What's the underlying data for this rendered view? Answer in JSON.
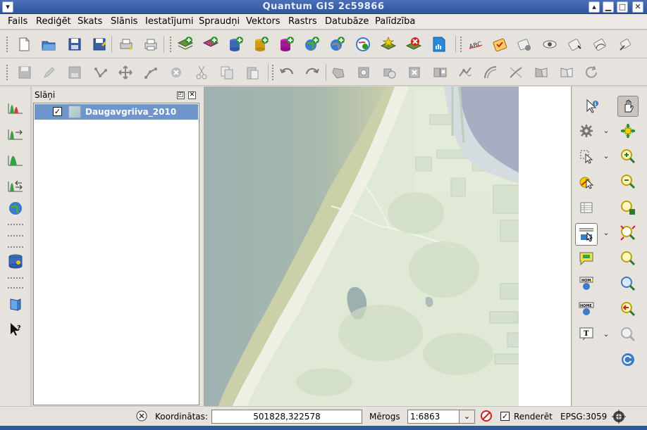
{
  "window": {
    "title": "Quantum GIS 2c59866",
    "close_glyph": "✕",
    "min_glyph": "▁",
    "max_glyph": "□",
    "shade_glyph": "▴",
    "menu_glyph": "▾"
  },
  "menubar": {
    "items": [
      "Fails",
      "Rediģēt",
      "Skats",
      "Slānis",
      "Iestatījumi",
      "Spraudņi",
      "Vektors",
      "Rastrs",
      "Datubāze",
      "Palīdzība"
    ]
  },
  "layers_panel": {
    "title": "Slāņi",
    "float_glyph": "◰",
    "close_glyph": "✕",
    "layers": [
      {
        "name": "Daugavgriiva_2010",
        "checked": "✓"
      }
    ]
  },
  "statusbar": {
    "coordinates_label": "Koordinātas:",
    "coordinates_value": "501828,322578",
    "scale_label": "Mērogs",
    "scale_value": "1:6863",
    "scale_dropdown_glyph": "⌄",
    "render_checked": "✓",
    "render_label": "Renderēt",
    "crs": "EPSG:3059"
  },
  "colors": {
    "titlebar": "#2f579e",
    "selection": "#6e95cc",
    "map_water": "#8fa6a8",
    "map_land": "#dfe9d5"
  },
  "icons": {
    "toolbar1": [
      "new-project-icon",
      "open-project-icon",
      "save-project-icon",
      "save-as-icon",
      "print-composer-icon",
      "print-icon",
      "add-vector-icon",
      "add-raster-icon",
      "add-postgis-icon",
      "add-spatialite-icon",
      "add-mssql-icon",
      "add-wms-icon",
      "add-wcs-icon",
      "add-wfs-icon",
      "new-vector-icon",
      "remove-layer-icon",
      "gps-icon",
      "label-icon",
      "layer-label-icon",
      "pin-label-icon",
      "show-hide-label-icon",
      "move-label-icon",
      "rotate-label-icon",
      "change-label-icon"
    ],
    "toolbar2": [
      "toggle-edit-icon",
      "pencil-icon",
      "save-edits-icon",
      "add-feature-icon",
      "move-feature-icon",
      "node-tool-icon",
      "delete-selected-icon",
      "cut-icon",
      "copy-icon",
      "paste-icon",
      "undo-icon",
      "redo-icon",
      "simplify-icon",
      "add-ring-icon",
      "add-part-icon",
      "delete-ring-icon",
      "delete-part-icon",
      "reshape-icon",
      "offset-curve-icon",
      "split-icon",
      "merge-icon",
      "merge-attributes-icon",
      "rotate-icon"
    ]
  }
}
